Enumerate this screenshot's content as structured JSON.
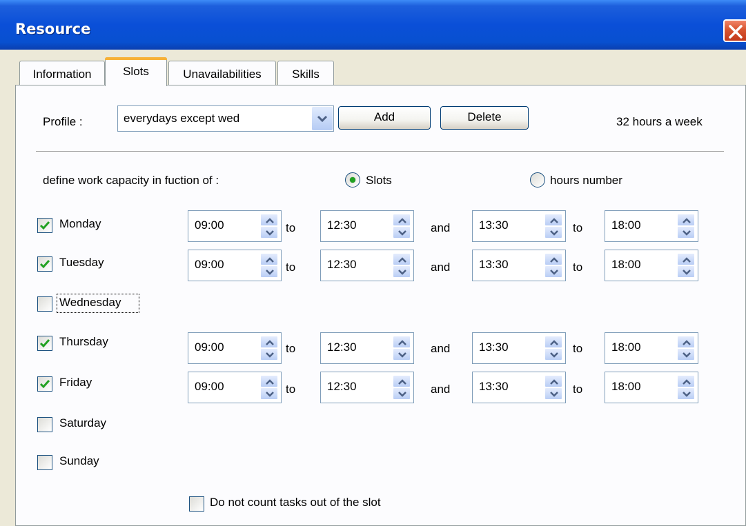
{
  "window": {
    "title": "Resource"
  },
  "tabs": [
    {
      "label": "Information",
      "active": false
    },
    {
      "label": "Slots",
      "active": true
    },
    {
      "label": "Unavailabilities",
      "active": false
    },
    {
      "label": "Skills",
      "active": false
    }
  ],
  "profile": {
    "label": "Profile :",
    "value": "everydays except wed",
    "add_label": "Add",
    "delete_label": "Delete",
    "hours_summary": "32 hours a week"
  },
  "capacity": {
    "label": "define work capacity in fuction of :",
    "options": [
      {
        "label": "Slots",
        "selected": true
      },
      {
        "label": "hours number",
        "selected": false
      }
    ]
  },
  "connectors": {
    "to": "to",
    "and": "and"
  },
  "days": [
    {
      "name": "Monday",
      "checked": true,
      "slots": [
        "09:00",
        "12:30",
        "13:30",
        "18:00"
      ]
    },
    {
      "name": "Tuesday",
      "checked": true,
      "slots": [
        "09:00",
        "12:30",
        "13:30",
        "18:00"
      ]
    },
    {
      "name": "Wednesday",
      "checked": false,
      "slots": []
    },
    {
      "name": "Thursday",
      "checked": true,
      "slots": [
        "09:00",
        "12:30",
        "13:30",
        "18:00"
      ]
    },
    {
      "name": "Friday",
      "checked": true,
      "slots": [
        "09:00",
        "12:30",
        "13:30",
        "18:00"
      ]
    },
    {
      "name": "Saturday",
      "checked": false,
      "slots": []
    },
    {
      "name": "Sunday",
      "checked": false,
      "slots": []
    }
  ],
  "footer": {
    "out_of_slot_label": "Do not count tasks out of the slot",
    "out_of_slot_checked": false
  },
  "colors": {
    "title_bar": "#0a4fd8",
    "tab_highlight": "#f7b137",
    "check_mark": "#21a121",
    "close_button": "#d8542f"
  }
}
